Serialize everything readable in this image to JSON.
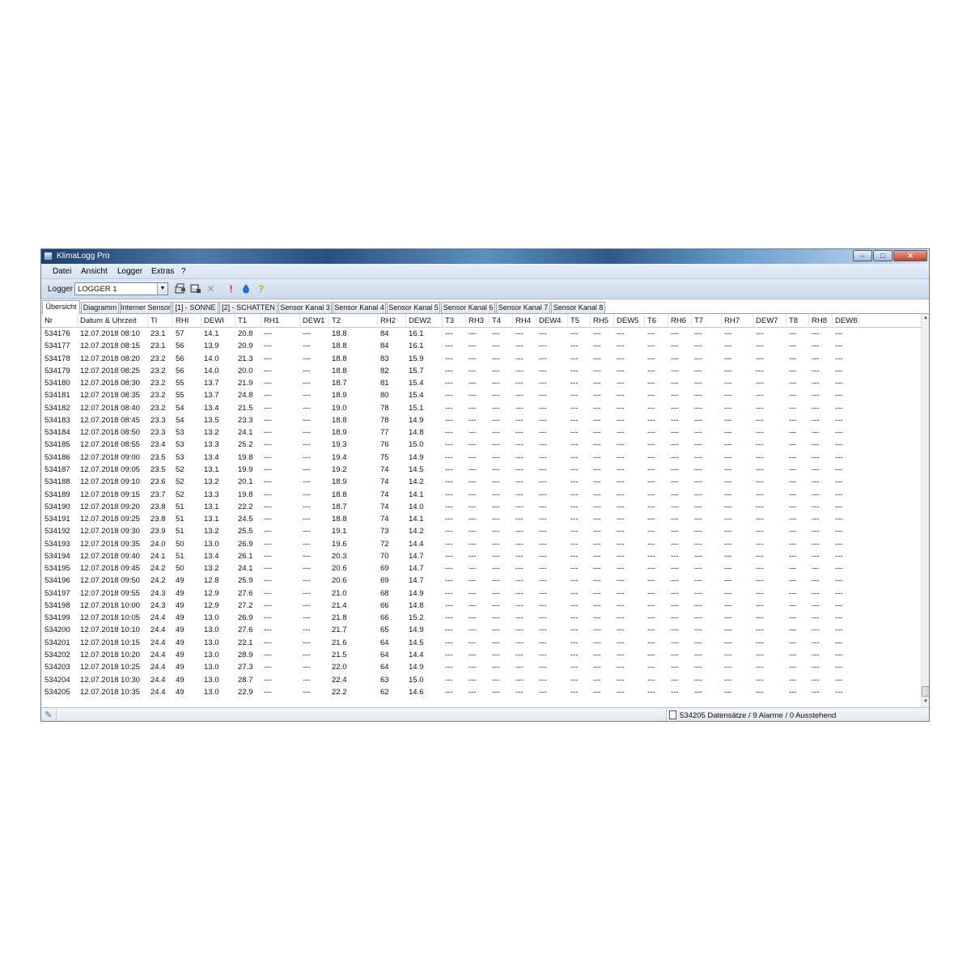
{
  "window": {
    "title": "KlimaLogg Pro",
    "controls": {
      "minimize": "–",
      "maximize": "□",
      "close": "✕"
    }
  },
  "menu": [
    "Datei",
    "Ansicht",
    "Logger",
    "Extras",
    "?"
  ],
  "toolbar": {
    "logger_label": "Logger",
    "logger_value": "LOGGER 1",
    "icons": [
      "open-folder-icon",
      "save-download-icon",
      "delete-x-icon",
      "alarm-exclamation-icon",
      "dewpoint-drop-icon",
      "help-icon"
    ],
    "alarm_color": "#e01010",
    "drop_color": "#1a6fd6",
    "help_color": "#c9a400"
  },
  "tabs": [
    "Übersicht",
    "Diagramm",
    "Interner Sensor",
    "[1] - SONNE",
    "[2] - SCHATTEN",
    "Sensor Kanal 3",
    "Sensor Kanal 4",
    "Sensor Kanal 5",
    "Sensor Kanal 6",
    "Sensor Kanal 7",
    "Sensor Kanal 8"
  ],
  "active_tab": "Übersicht",
  "table": {
    "columns": [
      "Nr",
      "Datum & Uhrzeit",
      "TI",
      "RHI",
      "DEWI",
      "T1",
      "RH1",
      "DEW1",
      "T2",
      "RH2",
      "DEW2",
      "T3",
      "RH3",
      "T4",
      "RH4",
      "DEW4",
      "T5",
      "RH5",
      "DEW5",
      "T6",
      "RH6",
      "T7",
      "RH7",
      "DEW7",
      "T8",
      "RH8",
      "DEW8"
    ],
    "empty_value": "---",
    "rows": [
      [
        "534176",
        "12.07.2018 08:10",
        "23.1",
        "57",
        "14.1",
        "20.8",
        "18.8",
        "84",
        "16.1"
      ],
      [
        "534177",
        "12.07.2018 08:15",
        "23.1",
        "56",
        "13.9",
        "20.9",
        "18.8",
        "84",
        "16.1"
      ],
      [
        "534178",
        "12.07.2018 08:20",
        "23.2",
        "56",
        "14.0",
        "21.3",
        "18.8",
        "83",
        "15.9"
      ],
      [
        "534179",
        "12.07.2018 08:25",
        "23.2",
        "56",
        "14.0",
        "20.0",
        "18.8",
        "82",
        "15.7"
      ],
      [
        "534180",
        "12.07.2018 08:30",
        "23.2",
        "55",
        "13.7",
        "21.9",
        "18.7",
        "81",
        "15.4"
      ],
      [
        "534181",
        "12.07.2018 08:35",
        "23.2",
        "55",
        "13.7",
        "24.8",
        "18.9",
        "80",
        "15.4"
      ],
      [
        "534182",
        "12.07.2018 08:40",
        "23.2",
        "54",
        "13.4",
        "21.5",
        "19.0",
        "78",
        "15.1"
      ],
      [
        "534183",
        "12.07.2018 08:45",
        "23.3",
        "54",
        "13.5",
        "23.3",
        "18.8",
        "78",
        "14.9"
      ],
      [
        "534184",
        "12.07.2018 08:50",
        "23.3",
        "53",
        "13.2",
        "24.1",
        "18.9",
        "77",
        "14.8"
      ],
      [
        "534185",
        "12.07.2018 08:55",
        "23.4",
        "53",
        "13.3",
        "25.2",
        "19.3",
        "76",
        "15.0"
      ],
      [
        "534186",
        "12.07.2018 09:00",
        "23.5",
        "53",
        "13.4",
        "19.8",
        "19.4",
        "75",
        "14.9"
      ],
      [
        "534187",
        "12.07.2018 09:05",
        "23.5",
        "52",
        "13.1",
        "19.9",
        "19.2",
        "74",
        "14.5"
      ],
      [
        "534188",
        "12.07.2018 09:10",
        "23.6",
        "52",
        "13.2",
        "20.1",
        "18.9",
        "74",
        "14.2"
      ],
      [
        "534189",
        "12.07.2018 09:15",
        "23.7",
        "52",
        "13.3",
        "19.8",
        "18.8",
        "74",
        "14.1"
      ],
      [
        "534190",
        "12.07.2018 09:20",
        "23.8",
        "51",
        "13.1",
        "22.2",
        "18.7",
        "74",
        "14.0"
      ],
      [
        "534191",
        "12.07.2018 09:25",
        "23.8",
        "51",
        "13.1",
        "24.5",
        "18.8",
        "74",
        "14.1"
      ],
      [
        "534192",
        "12.07.2018 09:30",
        "23.9",
        "51",
        "13.2",
        "25.5",
        "19.1",
        "73",
        "14.2"
      ],
      [
        "534193",
        "12.07.2018 09:35",
        "24.0",
        "50",
        "13.0",
        "26.9",
        "19.6",
        "72",
        "14.4"
      ],
      [
        "534194",
        "12.07.2018 09:40",
        "24.1",
        "51",
        "13.4",
        "26.1",
        "20.3",
        "70",
        "14.7"
      ],
      [
        "534195",
        "12.07.2018 09:45",
        "24.2",
        "50",
        "13.2",
        "24.1",
        "20.6",
        "69",
        "14.7"
      ],
      [
        "534196",
        "12.07.2018 09:50",
        "24.2",
        "49",
        "12.8",
        "25.9",
        "20.6",
        "69",
        "14.7"
      ],
      [
        "534197",
        "12.07.2018 09:55",
        "24.3",
        "49",
        "12.9",
        "27.6",
        "21.0",
        "68",
        "14.9"
      ],
      [
        "534198",
        "12.07.2018 10:00",
        "24.3",
        "49",
        "12.9",
        "27.2",
        "21.4",
        "66",
        "14.8"
      ],
      [
        "534199",
        "12.07.2018 10:05",
        "24.4",
        "49",
        "13.0",
        "26.9",
        "21.8",
        "66",
        "15.2"
      ],
      [
        "534200",
        "12.07.2018 10:10",
        "24.4",
        "49",
        "13.0",
        "27.6",
        "21.7",
        "65",
        "14.9"
      ],
      [
        "534201",
        "12.07.2018 10:15",
        "24.4",
        "49",
        "13.0",
        "22.1",
        "21.6",
        "64",
        "14.5"
      ],
      [
        "534202",
        "12.07.2018 10:20",
        "24.4",
        "49",
        "13.0",
        "28.9",
        "21.5",
        "64",
        "14.4"
      ],
      [
        "534203",
        "12.07.2018 10:25",
        "24.4",
        "49",
        "13.0",
        "27.3",
        "22.0",
        "64",
        "14.9"
      ],
      [
        "534204",
        "12.07.2018 10:30",
        "24.4",
        "49",
        "13.0",
        "28.7",
        "22.4",
        "63",
        "15.0"
      ],
      [
        "534205",
        "12.07.2018 10:35",
        "24.4",
        "49",
        "13.0",
        "22.9",
        "22.2",
        "62",
        "14.6"
      ]
    ]
  },
  "statusbar": {
    "text": "534205 Datensätze / 9 Alarme / 0 Ausstehend"
  }
}
